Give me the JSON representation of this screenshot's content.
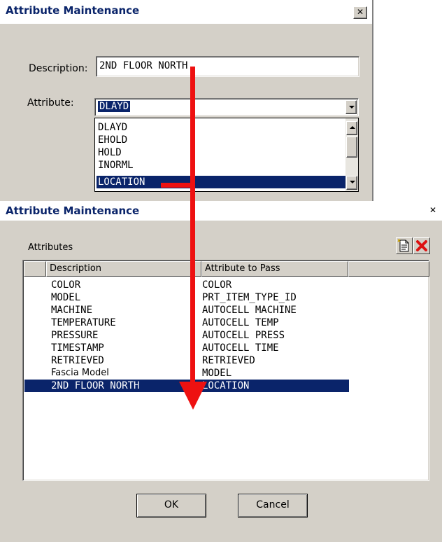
{
  "dialog_top": {
    "title": "Attribute Maintenance",
    "close_glyph": "✕",
    "description_label": "Description:",
    "description_value": "2ND FLOOR NORTH",
    "attribute_label": "Attribute:",
    "attribute_value": "DLAYD",
    "dropdown_items": [
      "DLAYD",
      "EHOLD",
      "HOLD",
      "INORML",
      "LOCATION"
    ],
    "selected_item": "LOCATION"
  },
  "dialog_bottom": {
    "title": "Attribute Maintenance",
    "close_glyph": "✕",
    "attributes_label": "Attributes",
    "columns": [
      "Description",
      "Attribute to Pass"
    ],
    "rows": [
      {
        "description": "COLOR",
        "attribute": "COLOR"
      },
      {
        "description": "MODEL",
        "attribute": "PRT_ITEM_TYPE_ID"
      },
      {
        "description": "MACHINE",
        "attribute": "AUTOCELL MACHINE"
      },
      {
        "description": "TEMPERATURE",
        "attribute": "AUTOCELL TEMP"
      },
      {
        "description": "PRESSURE",
        "attribute": "AUTOCELL PRESS"
      },
      {
        "description": "TIMESTAMP",
        "attribute": "AUTOCELL TIME"
      },
      {
        "description": "RETRIEVED",
        "attribute": "RETRIEVED"
      },
      {
        "description": "Fascia Model",
        "attribute": "MODEL"
      },
      {
        "description": "2ND FLOOR NORTH",
        "attribute": "LOCATION"
      }
    ],
    "selected_row_index": 8,
    "ok_label": "OK",
    "cancel_label": "Cancel",
    "icons": [
      "new-document-icon",
      "delete-icon"
    ]
  },
  "annotation": {
    "arrow_color": "#ee1111",
    "selection_color": "#0a246a"
  }
}
